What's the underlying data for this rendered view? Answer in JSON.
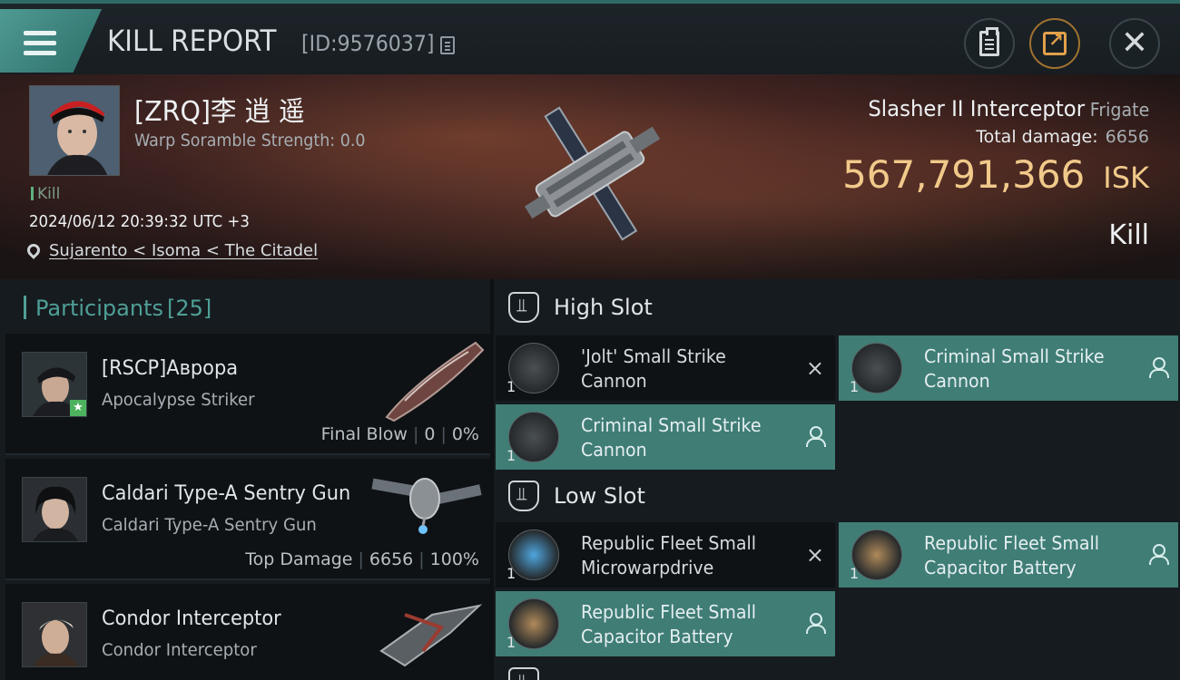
{
  "header": {
    "title": "KILL REPORT",
    "report_id": "[ID:9576037]"
  },
  "victim": {
    "name": "[ZRQ]李 逍 遥",
    "scramble": "Warp Soramble Strength: 0.0",
    "tag": "Kill",
    "datetime": "2024/06/12 20:39:32 UTC +3",
    "location": "Sujarento < Isoma < The Citadel",
    "ship": "Slasher II Interceptor",
    "ship_class": "Frigate",
    "total_damage_label": "Total damage:",
    "total_damage": "6656",
    "isk_value": "567,791,366",
    "isk_unit": "ISK",
    "result": "Kill"
  },
  "participants": {
    "label": "Participants",
    "count": "[25]",
    "items": [
      {
        "name": "[RSCP]Аврора",
        "ship": "Apocalypse Striker",
        "stat_label": "Final Blow",
        "damage": "0",
        "percent": "0%"
      },
      {
        "name": "Caldari Type-A Sentry Gun",
        "ship": "Caldari Type-A Sentry Gun",
        "stat_label": "Top Damage",
        "damage": "6656",
        "percent": "100%"
      },
      {
        "name": "Condor Interceptor",
        "ship": "Condor Interceptor"
      }
    ]
  },
  "fitting": {
    "high_slot_label": "High Slot",
    "low_slot_label": "Low Slot",
    "high": [
      {
        "name": "'Jolt' Small Strike Cannon",
        "qty": "1",
        "status": "×"
      },
      {
        "name": "Criminal Small Strike Cannon",
        "qty": "1"
      },
      {
        "name": "Criminal Small Strike Cannon",
        "qty": "1"
      }
    ],
    "low": [
      {
        "name": "Republic Fleet Small Microwarpdrive",
        "qty": "1",
        "status": "×"
      },
      {
        "name": "Republic Fleet Small Capacitor Battery",
        "qty": "1"
      },
      {
        "name": "Republic Fleet Small Capacitor Battery",
        "qty": "1"
      }
    ]
  }
}
